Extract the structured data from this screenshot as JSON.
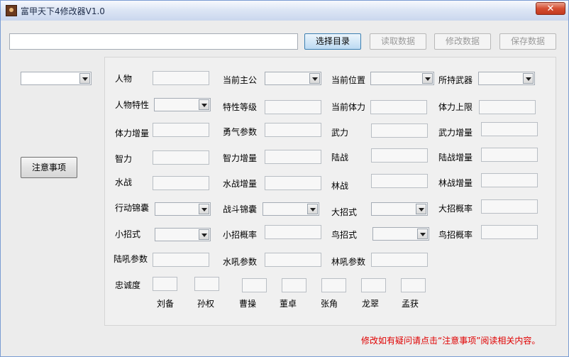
{
  "window": {
    "title": "富甲天下4修改器V1.0",
    "close_label": "✕"
  },
  "toolbar": {
    "path_value": "",
    "select_dir": "选择目录",
    "read_data": "读取数据",
    "modify_data": "修改数据",
    "save_data": "保存数据"
  },
  "sidebar": {
    "notice_button": "注意事项"
  },
  "labels": {
    "character": "人物",
    "current_lord": "当前主公",
    "current_location": "当前位置",
    "weapon": "所持武器",
    "char_trait": "人物特性",
    "trait_level": "特性等级",
    "current_stamina": "当前体力",
    "stamina_max": "体力上限",
    "stamina_inc": "体力增量",
    "courage": "勇气参数",
    "force": "武力",
    "force_inc": "武力增量",
    "intel": "智力",
    "intel_inc": "智力增量",
    "land_battle": "陆战",
    "land_battle_inc": "陆战增量",
    "water_battle": "水战",
    "water_battle_inc": "水战增量",
    "forest_battle": "林战",
    "forest_battle_inc": "林战增量",
    "action_bag": "行动锦囊",
    "battle_bag": "战斗锦囊",
    "big_move": "大招式",
    "big_move_rate": "大招概率",
    "small_move": "小招式",
    "small_move_rate": "小招概率",
    "bird_move": "鸟招式",
    "bird_move_rate": "鸟招概率",
    "land_roar": "陆吼参数",
    "water_roar": "水吼参数",
    "forest_roar": "林吼参数",
    "loyalty": "忠诚度"
  },
  "loyalty_names": [
    "刘备",
    "孙权",
    "曹操",
    "董卓",
    "张角",
    "龙翠",
    "孟获"
  ],
  "footer": {
    "notice": "修改如有疑问请点击“注意事项”阅读相关内容。"
  }
}
